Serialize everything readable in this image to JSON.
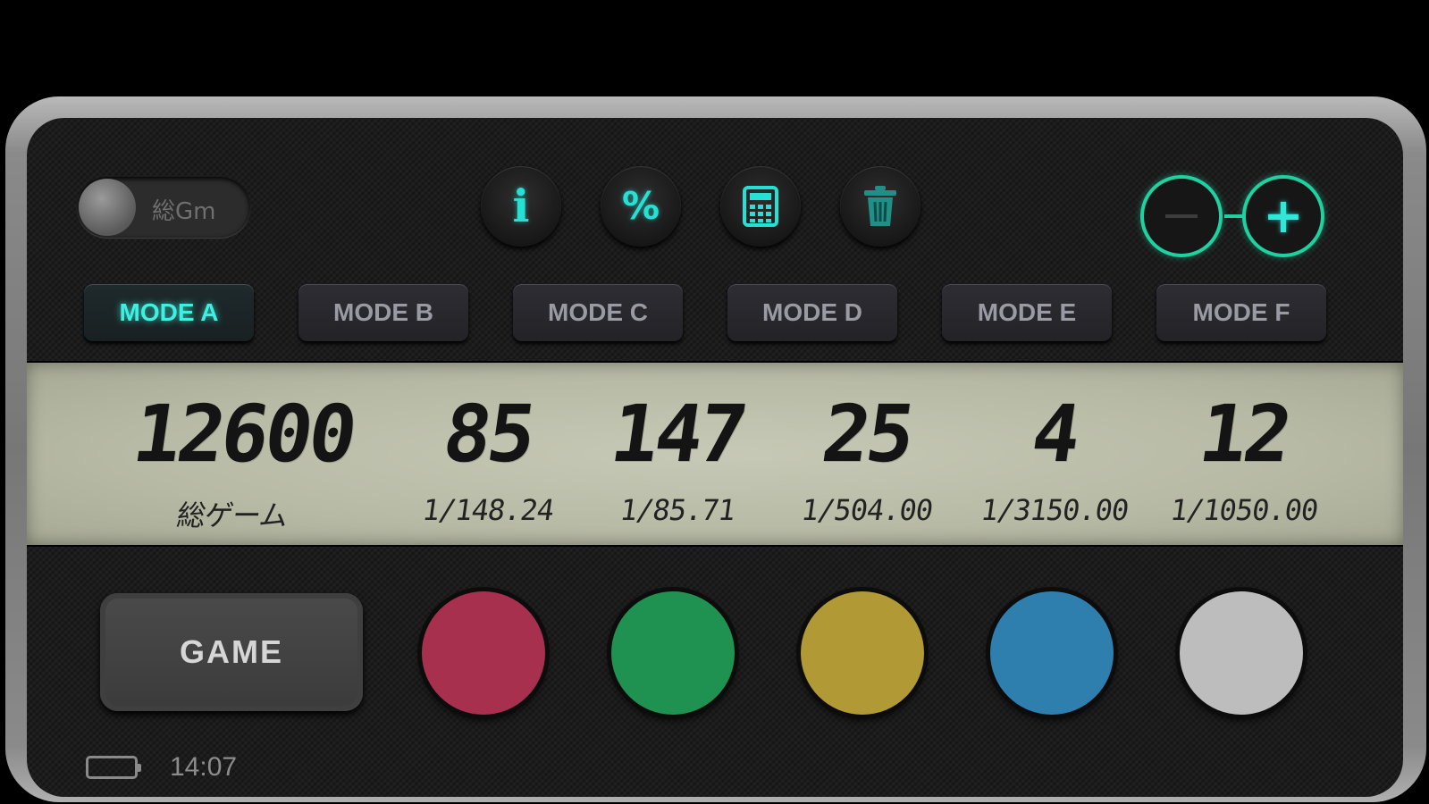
{
  "toggle": {
    "label": "総Gm",
    "on": false
  },
  "toolbar": {
    "info_icon": "info-icon",
    "percent_icon": "percent-icon",
    "calculator_icon": "calculator-icon",
    "trash_icon": "trash-icon",
    "minus_icon": "minus-icon",
    "plus_icon": "plus-icon",
    "accent_color": "#27e0d4"
  },
  "modes": [
    {
      "label": "MODE A",
      "active": true
    },
    {
      "label": "MODE B",
      "active": false
    },
    {
      "label": "MODE C",
      "active": false
    },
    {
      "label": "MODE D",
      "active": false
    },
    {
      "label": "MODE E",
      "active": false
    },
    {
      "label": "MODE F",
      "active": false
    }
  ],
  "lcd": {
    "cells": [
      {
        "value": "12600",
        "sub": "総ゲーム"
      },
      {
        "value": "85",
        "sub": "1/148.24"
      },
      {
        "value": "147",
        "sub": "1/85.71"
      },
      {
        "value": "25",
        "sub": "1/504.00"
      },
      {
        "value": "4",
        "sub": "1/3150.00"
      },
      {
        "value": "12",
        "sub": "1/1050.00"
      }
    ]
  },
  "bottom": {
    "game_label": "GAME",
    "color_buttons": [
      {
        "name": "red",
        "color": "#a8304f"
      },
      {
        "name": "green",
        "color": "#1f9150"
      },
      {
        "name": "yellow",
        "color": "#b19a35"
      },
      {
        "name": "blue",
        "color": "#2f7fae"
      },
      {
        "name": "white",
        "color": "#bdbdbd"
      }
    ]
  },
  "status": {
    "time": "14:07",
    "battery_icon": "battery-icon"
  }
}
